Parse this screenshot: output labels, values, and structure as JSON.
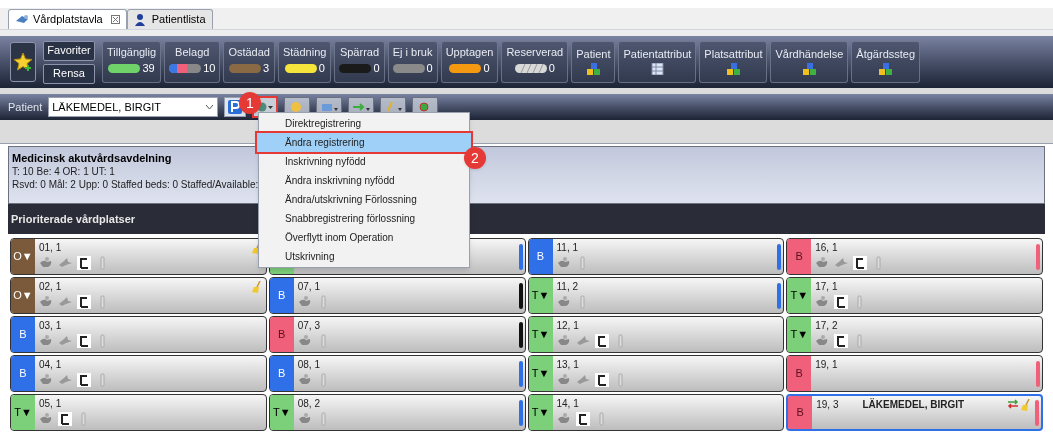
{
  "tabs": [
    {
      "label": "Vårdplatstavla",
      "selected": true,
      "closable": true,
      "kind": "board"
    },
    {
      "label": "Patientlista",
      "selected": false,
      "closable": false,
      "kind": "person"
    }
  ],
  "toolbar": {
    "favorites": [
      "Favoriter",
      "Rensa"
    ],
    "filters": [
      {
        "label": "Tillgänglig",
        "count": "39",
        "color": "#6fd36a",
        "kind": "pill"
      },
      {
        "label": "Belagd",
        "count": "10",
        "color": "#3a78e8",
        "kind": "split"
      },
      {
        "label": "Ostädad",
        "count": "3",
        "color": "#8a6a45",
        "kind": "pill"
      },
      {
        "label": "Städning",
        "count": "0",
        "color": "#f5e53a",
        "kind": "pill"
      },
      {
        "label": "Spärrad",
        "count": "0",
        "color": "#1a1a1a",
        "kind": "pill"
      },
      {
        "label": "Ej i bruk",
        "count": "0",
        "color": "#8a8a8a",
        "kind": "pill"
      },
      {
        "label": "Upptagen",
        "count": "0",
        "color": "#f59a10",
        "kind": "pill"
      },
      {
        "label": "Reserverad",
        "count": "0",
        "color": "#d8d8d8",
        "kind": "striped"
      }
    ],
    "attributes": [
      {
        "label": "Patient",
        "kind": "blocks"
      },
      {
        "label": "Patientattribut",
        "kind": "table"
      },
      {
        "label": "Platsattribut",
        "kind": "blocks"
      },
      {
        "label": "Vårdhändelse",
        "kind": "blocks"
      },
      {
        "label": "Åtgärdssteg",
        "kind": "blocks"
      }
    ]
  },
  "patient_bar": {
    "label": "Patient",
    "value": "LÄKEMEDEL, BIRGIT"
  },
  "menu": {
    "items": [
      {
        "label": "Direktregistrering",
        "selected": false
      },
      {
        "label": "Ändra registrering",
        "selected": true
      },
      {
        "label": "Inskrivning nyfödd",
        "selected": false
      },
      {
        "label": "Ändra inskrivning nyfödd",
        "selected": false
      },
      {
        "label": "Ändra/utskrivning Förlossning",
        "selected": false
      },
      {
        "label": "Snabbregistrering förlossning",
        "selected": false
      },
      {
        "label": "Överflytt inom Operation",
        "selected": false
      },
      {
        "label": "Utskrivning",
        "selected": false
      }
    ]
  },
  "callouts": [
    "1",
    "2"
  ],
  "department": {
    "title": "Medicinsk akutvårdsavdelning",
    "line_1": "T: 10 Be: 4 OR: 1 UT: 1",
    "line_2": "Rsvd: 0 Mål: 2 Upp: 0 Staffed beds: 0 Staffed/Available:"
  },
  "section_title": "Prioriterade vårdplatser",
  "columns": [
    [
      {
        "label": "01, 1",
        "status": "O▼",
        "color": "#7a5a3a",
        "icons": [
          {
            "kind": "hand"
          },
          {
            "kind": "bird"
          },
          {
            "kind": "bed"
          },
          {
            "kind": "bottle"
          }
        ],
        "cleaning": true
      },
      {
        "label": "02, 1",
        "status": "O▼",
        "color": "#7a5a3a",
        "icons": [
          {
            "kind": "hand"
          },
          {
            "kind": "bird"
          },
          {
            "kind": "bed"
          },
          {
            "kind": "bottle"
          }
        ],
        "cleaning": true
      },
      {
        "label": "03, 1",
        "status": "B",
        "color": "#2f6fe8",
        "icons": [
          {
            "kind": "hand"
          },
          {
            "kind": "bird"
          },
          {
            "kind": "bed"
          },
          {
            "kind": "bottle"
          }
        ]
      },
      {
        "label": "04, 1",
        "status": "B",
        "color": "#2f6fe8",
        "icons": [
          {
            "kind": "hand"
          },
          {
            "kind": "bird"
          },
          {
            "kind": "bed"
          },
          {
            "kind": "bottle"
          }
        ]
      },
      {
        "label": "05, 1",
        "status": "T▼",
        "color": "#7dd07a",
        "icons": [
          {
            "kind": "hand"
          },
          {
            "kind": "bed"
          },
          {
            "kind": "bottle"
          }
        ]
      }
    ],
    [
      {
        "color": "#7dd07a",
        "marker": {
          "color": "#2f6fe8"
        }
      },
      {
        "label": "07, 1",
        "status": "B",
        "color": "#2f6fe8",
        "icons": [
          {
            "kind": "hand"
          },
          {
            "kind": "bottle"
          }
        ],
        "marker": {
          "color": "#111111"
        }
      },
      {
        "label": "07, 3",
        "status": "B",
        "color": "#f0607a",
        "icons": [
          {
            "kind": "hand"
          },
          {
            "kind": "bottle"
          }
        ],
        "marker": {
          "color": "#111111"
        }
      },
      {
        "label": "08, 1",
        "status": "B",
        "color": "#2f6fe8",
        "icons": [
          {
            "kind": "hand"
          },
          {
            "kind": "bottle"
          }
        ],
        "marker": {
          "color": "#2f6fe8"
        }
      },
      {
        "label": "08, 2",
        "status": "T▼",
        "color": "#7dd07a",
        "icons": [
          {
            "kind": "hand"
          },
          {
            "kind": "bottle"
          }
        ],
        "marker": {
          "color": "#2f6fe8"
        }
      }
    ],
    [
      {
        "label": "11, 1",
        "status": "B",
        "color": "#2f6fe8",
        "icons": [
          {
            "kind": "hand"
          },
          {
            "kind": "bottle"
          }
        ],
        "marker": {
          "color": "#2f6fe8"
        }
      },
      {
        "label": "11, 2",
        "status": "T▼",
        "color": "#7dd07a",
        "icons": [
          {
            "kind": "hand"
          },
          {
            "kind": "bottle"
          }
        ],
        "marker": {
          "color": "#2f6fe8"
        }
      },
      {
        "label": "12, 1",
        "status": "T▼",
        "color": "#7dd07a",
        "icons": [
          {
            "kind": "hand"
          },
          {
            "kind": "bird"
          },
          {
            "kind": "bed"
          },
          {
            "kind": "bottle"
          }
        ]
      },
      {
        "label": "13, 1",
        "status": "T▼",
        "color": "#7dd07a",
        "icons": [
          {
            "kind": "hand"
          },
          {
            "kind": "bird"
          },
          {
            "kind": "bed"
          },
          {
            "kind": "bottle"
          }
        ]
      },
      {
        "label": "14, 1",
        "status": "T▼",
        "color": "#7dd07a",
        "icons": [
          {
            "kind": "hand"
          },
          {
            "kind": "bed"
          },
          {
            "kind": "bottle"
          }
        ]
      }
    ],
    [
      {
        "label": "16, 1",
        "status": "B",
        "color": "#f0607a",
        "icons": [
          {
            "kind": "hand"
          },
          {
            "kind": "bird"
          },
          {
            "kind": "bed"
          },
          {
            "kind": "bottle"
          }
        ],
        "marker": {
          "color": "#f0607a"
        }
      },
      {
        "label": "17, 1",
        "status": "T▼",
        "color": "#7dd07a",
        "icons": [
          {
            "kind": "hand"
          },
          {
            "kind": "bed"
          },
          {
            "kind": "bottle"
          }
        ]
      },
      {
        "label": "17, 2",
        "status": "T▼",
        "color": "#7dd07a",
        "icons": [
          {
            "kind": "hand"
          },
          {
            "kind": "bed"
          },
          {
            "kind": "bottle"
          }
        ]
      },
      {
        "label": "19, 1",
        "status": "B",
        "color": "#f0607a",
        "marker": {
          "color": "#f0607a"
        }
      },
      {
        "label": "19, 3",
        "status": "B",
        "color": "#f0607a",
        "patient": "LÄKEMEDEL, BIRGIT",
        "selected": true,
        "swap": true,
        "cleaning": true,
        "marker": {
          "color": "#f0607a"
        }
      }
    ]
  ]
}
